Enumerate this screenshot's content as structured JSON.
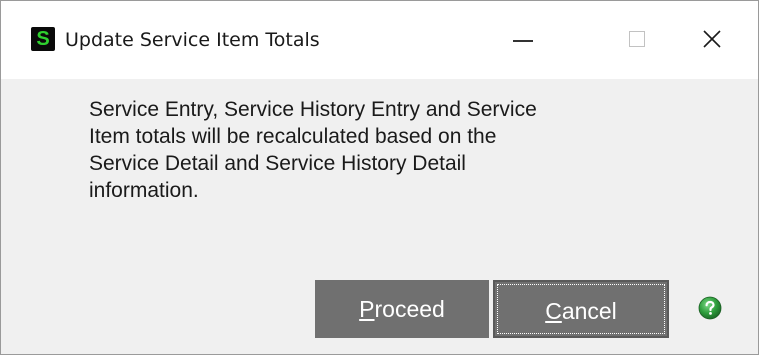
{
  "window": {
    "title": "Update Service Item Totals",
    "app_icon_letter": "S",
    "app_icon_color": "#2fd12f"
  },
  "message": {
    "lines": [
      "Service Entry, Service History Entry and Service",
      "Item totals will be recalculated based on the",
      "Service Detail and Service History Detail",
      "information."
    ]
  },
  "buttons": {
    "proceed": {
      "mnemonic": "P",
      "rest": "roceed"
    },
    "cancel": {
      "mnemonic": "C",
      "rest": "ancel"
    }
  },
  "icons": {
    "window_controls": [
      "minimize-icon",
      "maximize-icon",
      "close-icon"
    ],
    "help": "help-icon",
    "help_color": "#2e9e3c"
  }
}
